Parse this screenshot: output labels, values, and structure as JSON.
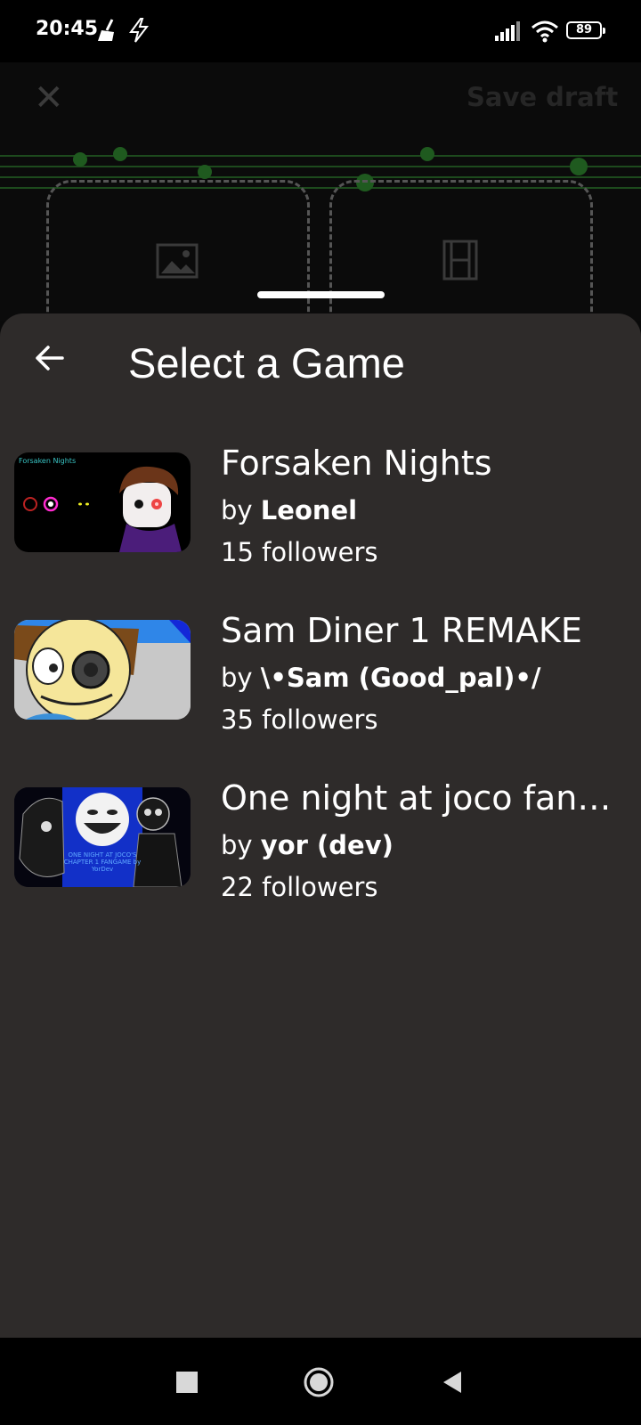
{
  "status_bar": {
    "time": "20:45",
    "battery": "89",
    "icons": [
      "broom-icon",
      "bolt-icon",
      "signal-icon",
      "wifi-icon",
      "battery-icon"
    ]
  },
  "background_editor": {
    "close_icon": "close-icon",
    "save_label": "Save draft",
    "slots": [
      "image-icon",
      "film-icon"
    ]
  },
  "sheet": {
    "title": "Select a Game",
    "back_icon": "arrow-left-icon",
    "games": [
      {
        "title": "Forsaken Nights",
        "by_prefix": "by",
        "author": "Leonel",
        "followers": "15 followers",
        "thumb_text": "Forsaken Nights"
      },
      {
        "title": "Sam Diner 1 REMAKE",
        "by_prefix": "by",
        "author": "\\•Sam (Good_pal)•/",
        "followers": "35 followers"
      },
      {
        "title": "One night at joco fangame",
        "by_prefix": "by",
        "author": "yor (dev)",
        "followers": "22 followers",
        "thumb_text": "ONE NIGHT AT JOCO'S CHAPTER 1 FANGAME by YorDev"
      }
    ]
  },
  "nav_bar": {
    "buttons": [
      "recents-icon",
      "home-icon",
      "back-icon"
    ]
  },
  "colors": {
    "sheet_bg": "#2e2b2a",
    "text": "#ffffff",
    "bar_bg": "#000000"
  }
}
